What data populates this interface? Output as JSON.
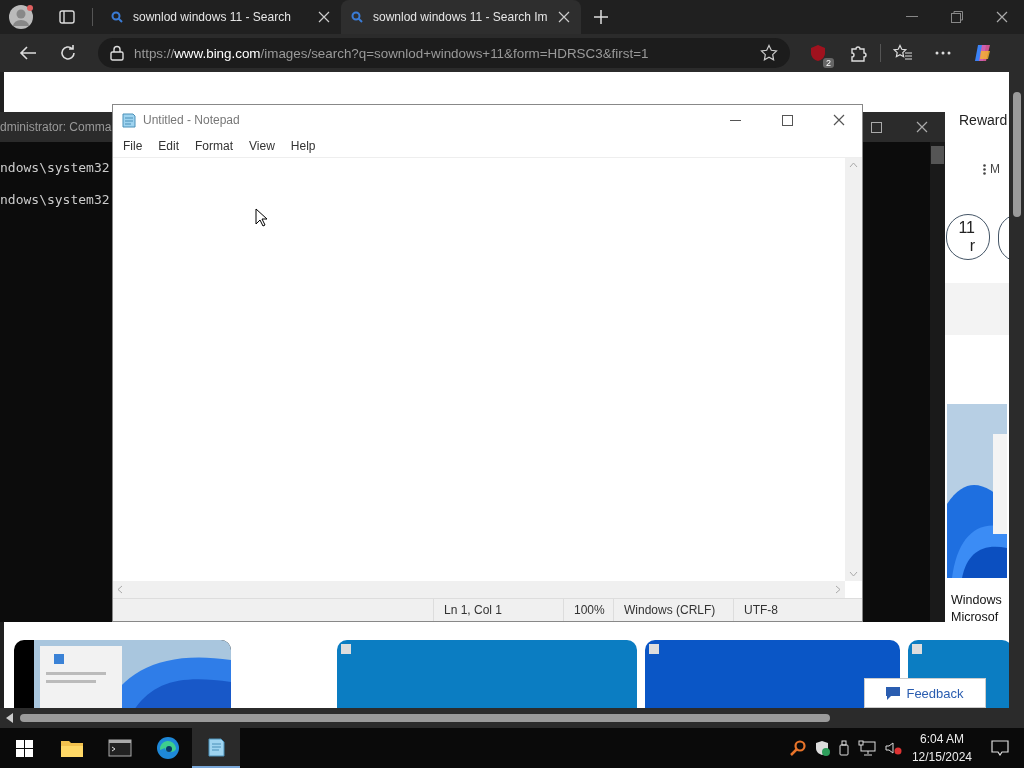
{
  "browser": {
    "tabs": [
      {
        "title": "sownlod windows 11 - Search",
        "selected": false
      },
      {
        "title": "sownlod windows 11 - Search Im",
        "selected": true
      }
    ],
    "url": {
      "scheme": "https://",
      "host": "www.bing.com",
      "path": "/images/search?q=sownlod+windows+11&form=HDRSC3&first=1"
    },
    "extension_badge": "2",
    "page": {
      "rewards_label": "Reward",
      "more_label": "M",
      "pill_lines": [
        "11",
        "r"
      ],
      "caption_lines": [
        "Windows",
        "Microsof"
      ],
      "feedback_label": "Feedback"
    }
  },
  "cmd_window": {
    "title": "dministrator: Comma",
    "lines": [
      "ndows\\system32",
      "ndows\\system32"
    ]
  },
  "notepad": {
    "title": "Untitled - Notepad",
    "menu": [
      "File",
      "Edit",
      "Format",
      "View",
      "Help"
    ],
    "status": [
      "Ln 1, Col 1",
      "100%",
      "Windows (CRLF)",
      "UTF-8"
    ]
  },
  "taskbar": {
    "apps": [
      {
        "kind": "explorer",
        "selected": false
      },
      {
        "kind": "terminal",
        "selected": false
      },
      {
        "kind": "edge",
        "selected": false
      },
      {
        "kind": "notepad",
        "selected": true
      }
    ],
    "time": "6:04 AM",
    "date": "12/15/2024"
  }
}
